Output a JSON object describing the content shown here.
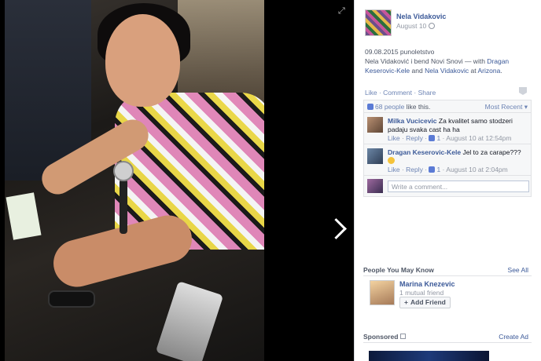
{
  "viewer": {
    "expand_icon": "expand-icon",
    "next_icon": "chevron-right-icon"
  },
  "post": {
    "author": "Nela Vidakovic",
    "date": "August 10",
    "caption_line1": "09.08.2015 punoletstvo",
    "caption_prefix": "Nela Vidaković i bend Novi Snovi — with ",
    "tag1": "Dragan Keserovic-Kele",
    "and": " and ",
    "tag2": "Nela Vidakovic",
    "at": " at ",
    "place": "Arizona",
    "period": "."
  },
  "actions": {
    "like": "Like",
    "sep1": " · ",
    "comment": "Comment",
    "sep2": " · ",
    "share": "Share"
  },
  "ufi": {
    "likes_count": "68 people",
    "likes_suffix": " like this.",
    "sort": "Most Recent ▾",
    "write_placeholder": "Write a comment..."
  },
  "comments": [
    {
      "name": "Milka Vucicevic",
      "text": " Za kvalitet samo stodzeri padaju svaka cast ha ha",
      "like": "Like",
      "reply": "Reply",
      "likes": "1",
      "time": "August 10 at 12:54pm"
    },
    {
      "name": "Dragan Keserovic-Kele",
      "text": " Jel to za carape???",
      "like": "Like",
      "reply": "Reply",
      "likes": "1",
      "time": "August 10 at 2:04pm"
    }
  ],
  "pymk": {
    "title": "People You May Know",
    "see_all": "See All",
    "name": "Marina Knezevic",
    "mutual": "1 mutual friend",
    "add_friend": "Add Friend"
  },
  "sponsored": {
    "title": "Sponsored",
    "create_ad": "Create Ad"
  },
  "colors": {
    "link": "#3b5998",
    "muted": "#9197a3"
  }
}
